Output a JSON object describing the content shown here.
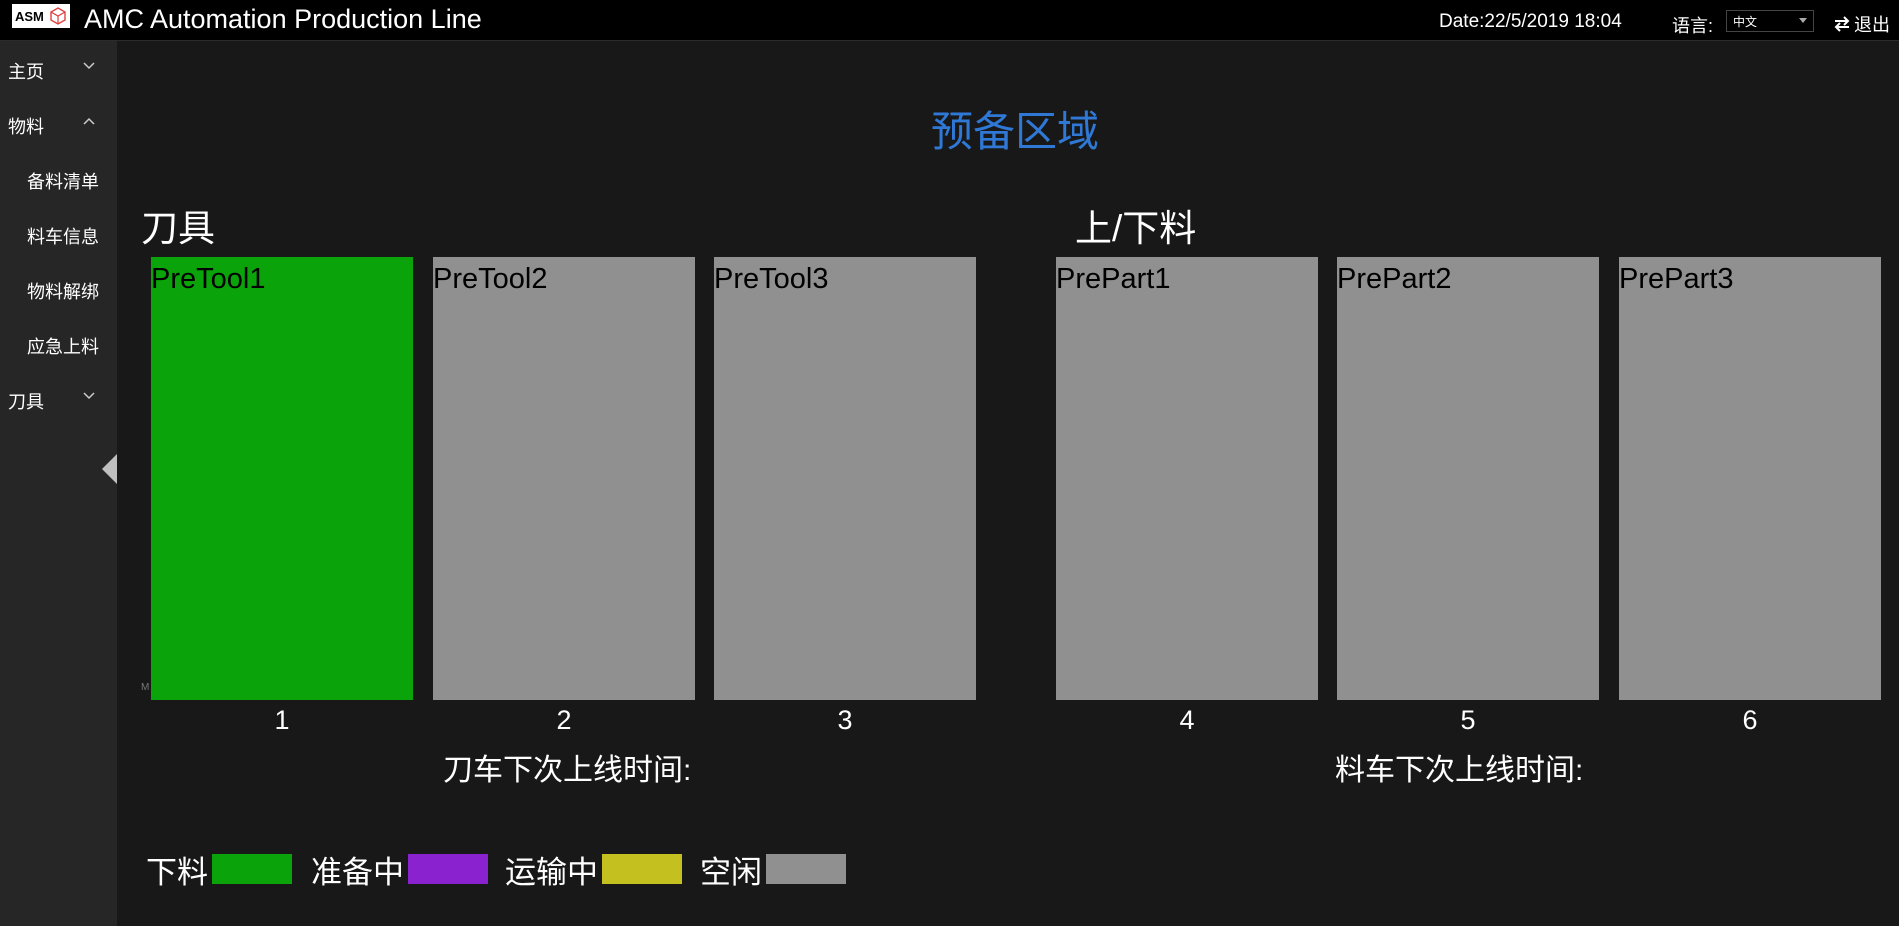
{
  "header": {
    "logo_text": "ASM",
    "app_title": "AMC Automation Production Line",
    "date": "Date:22/5/2019 18:04",
    "language_label": "语言:",
    "language_value": "中文",
    "logout_label": "退出"
  },
  "sidebar": {
    "items": [
      {
        "label": "主页",
        "chevron": "down"
      },
      {
        "label": "物料",
        "chevron": "up"
      },
      {
        "label": "备料清单"
      },
      {
        "label": "料车信息"
      },
      {
        "label": "物料解绑"
      },
      {
        "label": "应急上料"
      },
      {
        "label": "刀具",
        "chevron": "down"
      }
    ]
  },
  "main": {
    "page_title": "预备区域",
    "tool_section": {
      "title": "刀具",
      "next_time_label": "刀车下次上线时间:",
      "slots": [
        {
          "name": "PreTool1",
          "number": "1",
          "status": "下料"
        },
        {
          "name": "PreTool2",
          "number": "2",
          "status": "空闲"
        },
        {
          "name": "PreTool3",
          "number": "3",
          "status": "空闲"
        }
      ]
    },
    "part_section": {
      "title": "上/下料",
      "next_time_label": "料车下次上线时间:",
      "slots": [
        {
          "name": "PrePart1",
          "number": "4",
          "status": "空闲"
        },
        {
          "name": "PrePart2",
          "number": "5",
          "status": "空闲"
        },
        {
          "name": "PrePart3",
          "number": "6",
          "status": "空闲"
        }
      ]
    },
    "legend": [
      {
        "label": "下料",
        "color": "#0aa40a"
      },
      {
        "label": "准备中",
        "color": "#8a22d0"
      },
      {
        "label": "运输中",
        "color": "#c4c020"
      },
      {
        "label": "空闲",
        "color": "#909090"
      }
    ],
    "tiny_mark": "M"
  }
}
